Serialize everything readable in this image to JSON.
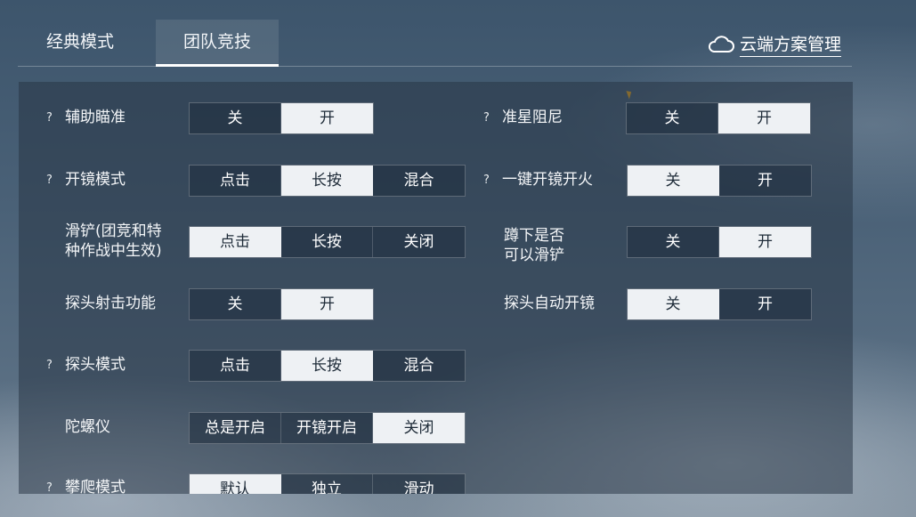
{
  "tabs": [
    {
      "label": "经典模式",
      "active": false
    },
    {
      "label": "团队竞技",
      "active": true
    }
  ],
  "cloud": {
    "label": "云端方案管理",
    "icon": "cloud-icon"
  },
  "help_mark": "?",
  "left_settings": [
    {
      "label": "辅助瞄准",
      "help": true,
      "options": [
        "关",
        "开"
      ],
      "selected": 1
    },
    {
      "label": "开镜模式",
      "help": true,
      "options": [
        "点击",
        "长按",
        "混合"
      ],
      "selected": 1
    },
    {
      "label": "滑铲(团竞和特种作战中生效)",
      "label_lines": [
        "滑铲(团竞和特",
        "种作战中生效)"
      ],
      "help": false,
      "options": [
        "点击",
        "长按",
        "关闭"
      ],
      "selected": 0
    },
    {
      "label": "探头射击功能",
      "help": false,
      "options": [
        "关",
        "开"
      ],
      "selected": 1
    },
    {
      "label": "探头模式",
      "help": true,
      "options": [
        "点击",
        "长按",
        "混合"
      ],
      "selected": 1
    },
    {
      "label": "陀螺仪",
      "help": false,
      "options": [
        "总是开启",
        "开镜开启",
        "关闭"
      ],
      "selected": 2
    },
    {
      "label": "攀爬模式",
      "help": true,
      "options": [
        "默认",
        "独立",
        "滑动"
      ],
      "selected": 0
    }
  ],
  "right_settings": [
    {
      "label": "准星阻尼",
      "help": true,
      "options": [
        "关",
        "开"
      ],
      "selected": 1
    },
    {
      "label": "一键开镜开火",
      "help": true,
      "options": [
        "关",
        "开"
      ],
      "selected": 0
    },
    {
      "label": "蹲下是否可以滑铲",
      "label_lines": [
        "蹲下是否",
        "可以滑铲"
      ],
      "help": false,
      "options": [
        "关",
        "开"
      ],
      "selected": 1
    },
    {
      "label": "探头自动开镜",
      "help": false,
      "options": [
        "关",
        "开"
      ],
      "selected": 0
    }
  ]
}
